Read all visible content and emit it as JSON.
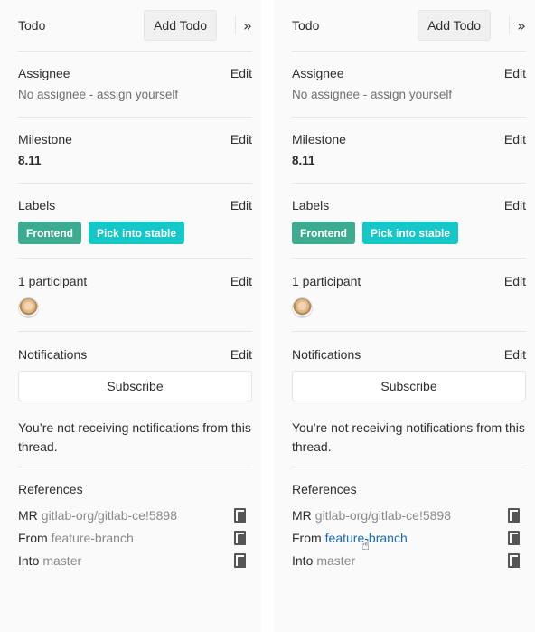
{
  "sidebar": {
    "todo_title": "Todo",
    "add_todo_label": "Add Todo",
    "collapse_glyph": "»",
    "assignee": {
      "title": "Assignee",
      "edit_label": "Edit",
      "value": "No assignee - assign yourself"
    },
    "milestone": {
      "title": "Milestone",
      "edit_label": "Edit",
      "value": "8.11"
    },
    "labels": {
      "title": "Labels",
      "edit_label": "Edit",
      "items": [
        {
          "text": "Frontend",
          "color": "#3cab8f"
        },
        {
          "text": "Pick into stable",
          "color": "#15c7c7"
        }
      ]
    },
    "participants": {
      "title": "1 participant",
      "edit_label": "Edit"
    },
    "notifications": {
      "title": "Notifications",
      "edit_label": "Edit",
      "subscribe_label": "Subscribe",
      "message": "You’re not receiving notifications from this thread."
    },
    "references": {
      "title": "References",
      "mr": {
        "key": "MR",
        "value": "gitlab-org/gitlab-ce!5898"
      },
      "from": {
        "key": "From",
        "value": "feature-branch"
      },
      "into": {
        "key": "Into",
        "value": "master"
      }
    }
  },
  "hover_state": {
    "from_link_color": "#1b69b6",
    "cursor": "pointer-hand-icon"
  }
}
